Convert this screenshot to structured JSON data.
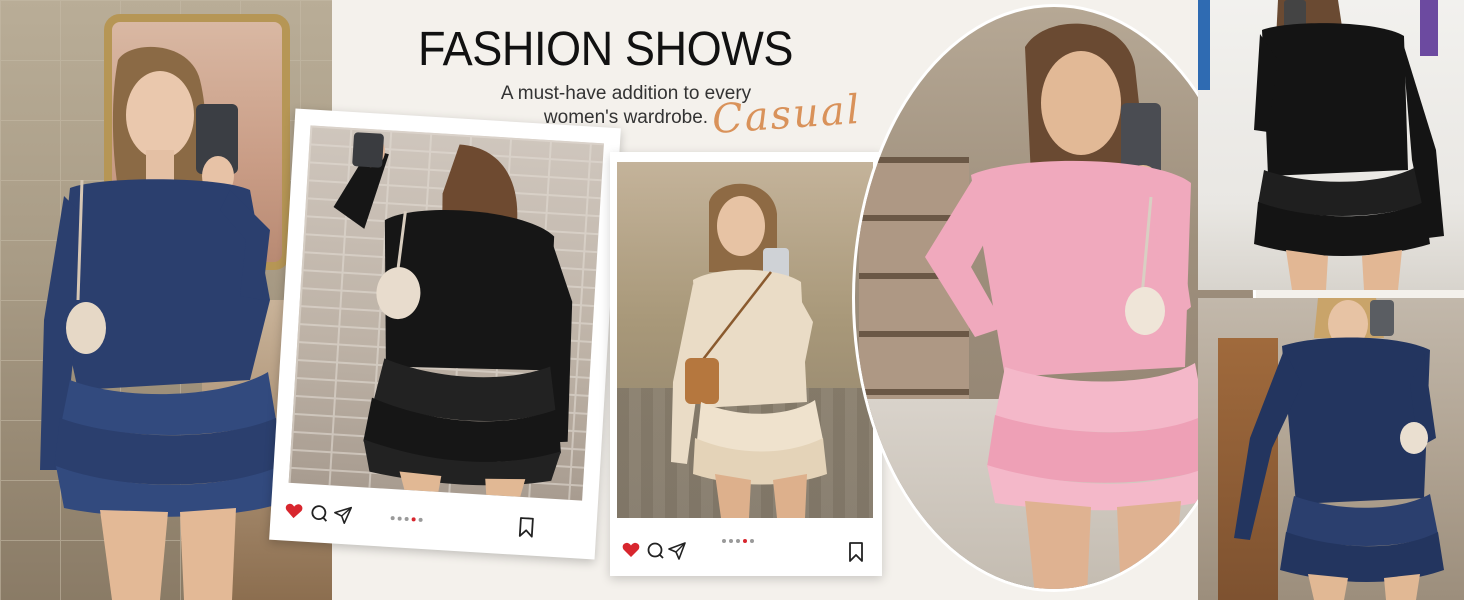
{
  "header": {
    "title": "FASHION SHOWS",
    "subtitle": "A must-have addition to every women's wardrobe.",
    "script_word": "Casual"
  },
  "colors": {
    "background": "#f4f1ec",
    "accent_script": "#d9925a",
    "like_heart": "#d8262e",
    "dress_navy": "#2b3f6e",
    "dress_black": "#161616",
    "dress_beige": "#eadcc6",
    "dress_pink": "#f0a9bd"
  },
  "photos": [
    {
      "name": "navy-romper-mirror-selfie",
      "dress_color": "navy"
    },
    {
      "name": "black-romper-polaroid",
      "dress_color": "black"
    },
    {
      "name": "beige-romper-polaroid",
      "dress_color": "beige"
    },
    {
      "name": "pink-romper-oval",
      "dress_color": "pink"
    },
    {
      "name": "black-romper-gallery",
      "dress_color": "black"
    },
    {
      "name": "navy-romper-bunkbed",
      "dress_color": "navy"
    }
  ],
  "social_icons": [
    "heart-icon",
    "comment-icon",
    "share-icon",
    "bookmark-icon"
  ],
  "carousel": {
    "total": 5,
    "active": 4
  }
}
